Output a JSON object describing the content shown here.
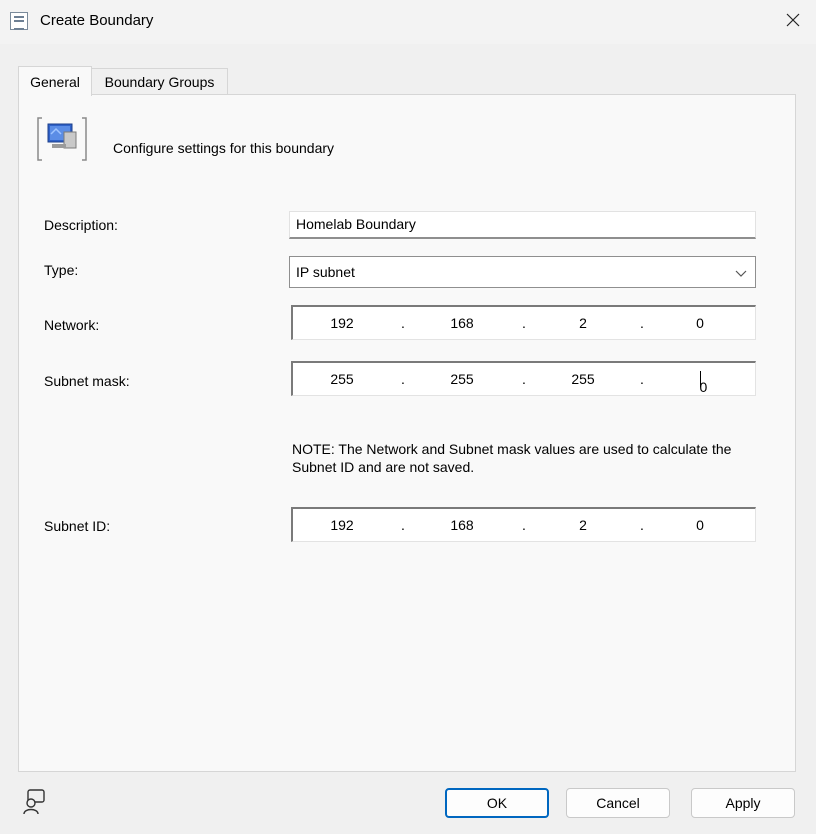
{
  "window": {
    "title": "Create Boundary",
    "title_icon": "properties-window-icon",
    "close_icon": "close-icon"
  },
  "tabs": [
    {
      "label": "General",
      "active": true
    },
    {
      "label": "Boundary Groups",
      "active": false
    }
  ],
  "general": {
    "header_icon": "boundary-computer-icon",
    "header_text": "Configure settings for this boundary",
    "description": {
      "label": "Description:",
      "value": "Homelab Boundary"
    },
    "type": {
      "label": "Type:",
      "value": "IP subnet"
    },
    "network": {
      "label": "Network:",
      "octets": [
        "192",
        "168",
        "2",
        "0"
      ],
      "separator": "."
    },
    "subnet_mask": {
      "label": "Subnet mask:",
      "octets": [
        "255",
        "255",
        "255",
        "0"
      ],
      "separator": "."
    },
    "note": "NOTE: The Network and Subnet mask values are used to calculate the Subnet ID and are not saved.",
    "subnet_id": {
      "label": "Subnet ID:",
      "octets": [
        "192",
        "168",
        "2",
        "0"
      ],
      "separator": "."
    }
  },
  "footer": {
    "help_icon": "user-help-icon",
    "ok_label": "OK",
    "cancel_label": "Cancel",
    "apply_label": "Apply"
  },
  "colors": {
    "accent": "#0067c0",
    "panel": "#f9f9f9",
    "background": "#f0f0f0"
  }
}
